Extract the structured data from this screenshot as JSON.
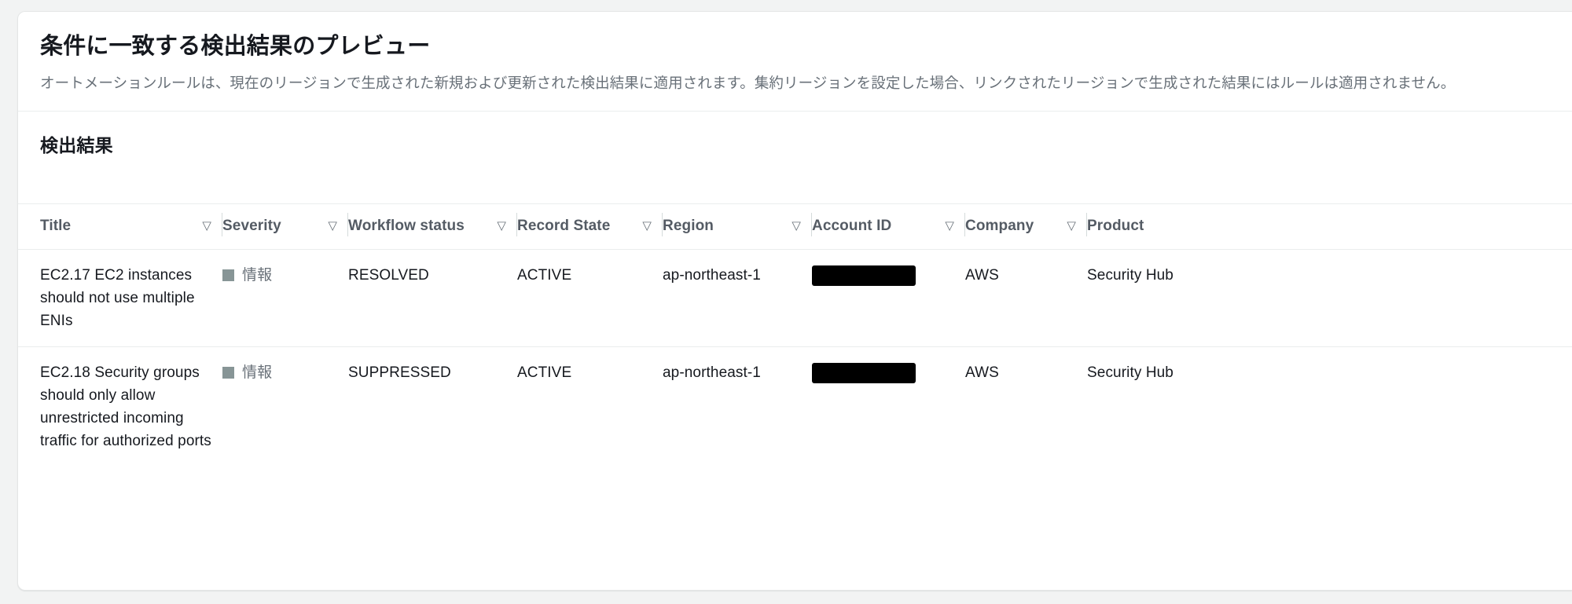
{
  "panel": {
    "title": "条件に一致する検出結果のプレビュー",
    "description": "オートメーションルールは、現在のリージョンで生成された新規および更新された検出結果に適用されます。集約リージョンを設定した場合、リンクされたリージョンで生成された結果にはルールは適用されません。",
    "section_title": "検出結果"
  },
  "table": {
    "columns": [
      {
        "label": "Title",
        "sortable": true,
        "sort_icon": "▽"
      },
      {
        "label": "Severity",
        "sortable": true,
        "sort_icon": "▽"
      },
      {
        "label": "Workflow status",
        "sortable": true,
        "sort_icon": "▽"
      },
      {
        "label": "Record State",
        "sortable": true,
        "sort_icon": "▽"
      },
      {
        "label": "Region",
        "sortable": true,
        "sort_icon": "▽"
      },
      {
        "label": "Account ID",
        "sortable": true,
        "sort_icon": "▽"
      },
      {
        "label": "Company",
        "sortable": true,
        "sort_icon": "▽"
      },
      {
        "label": "Product",
        "sortable": false,
        "sort_icon": ""
      }
    ],
    "rows": [
      {
        "title": "EC2.17 EC2 instances should not use multiple ENIs",
        "severity": "情報",
        "severity_color": "#879596",
        "workflow_status": "RESOLVED",
        "record_state": "ACTIVE",
        "region": "ap-northeast-1",
        "account_id": "",
        "account_id_redacted": true,
        "company": "AWS",
        "product": "Security Hub"
      },
      {
        "title": "EC2.18 Security groups should only allow unrestricted incoming traffic for authorized ports",
        "severity": "情報",
        "severity_color": "#879596",
        "workflow_status": "SUPPRESSED",
        "record_state": "ACTIVE",
        "region": "ap-northeast-1",
        "account_id": "",
        "account_id_redacted": true,
        "company": "AWS",
        "product": "Security Hub"
      }
    ]
  }
}
